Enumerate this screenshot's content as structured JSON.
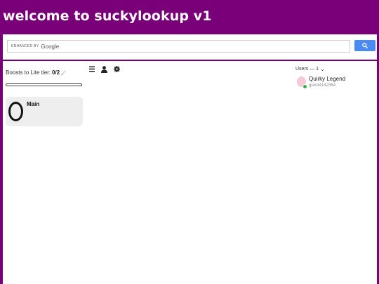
{
  "app": {
    "title": "welcome to suckylookup v1"
  },
  "search": {
    "placeholder_prefix": "ENHANCED BY",
    "placeholder_brand": "Google",
    "button_icon": "search-icon",
    "button_color": "#4a8af4"
  },
  "colors": {
    "background": "#7a007a",
    "panel": "#ffffff",
    "card": "#eeeeee",
    "online": "#2fb344"
  },
  "boosts": {
    "label": "Boosts to Lite tier:",
    "value": "0/2",
    "progress": 0,
    "icon": "rocket-icon"
  },
  "servers": [
    {
      "name": "Main",
      "icon": "ring-icon"
    }
  ],
  "toolbar": {
    "icons": [
      "menu-icon",
      "user-icon",
      "gear-icon"
    ]
  },
  "users": {
    "header": "Users — 1",
    "chevron": "⌄",
    "list": [
      {
        "name": "Quirky Legend",
        "handle": "guest4142354",
        "status": "online"
      }
    ]
  }
}
